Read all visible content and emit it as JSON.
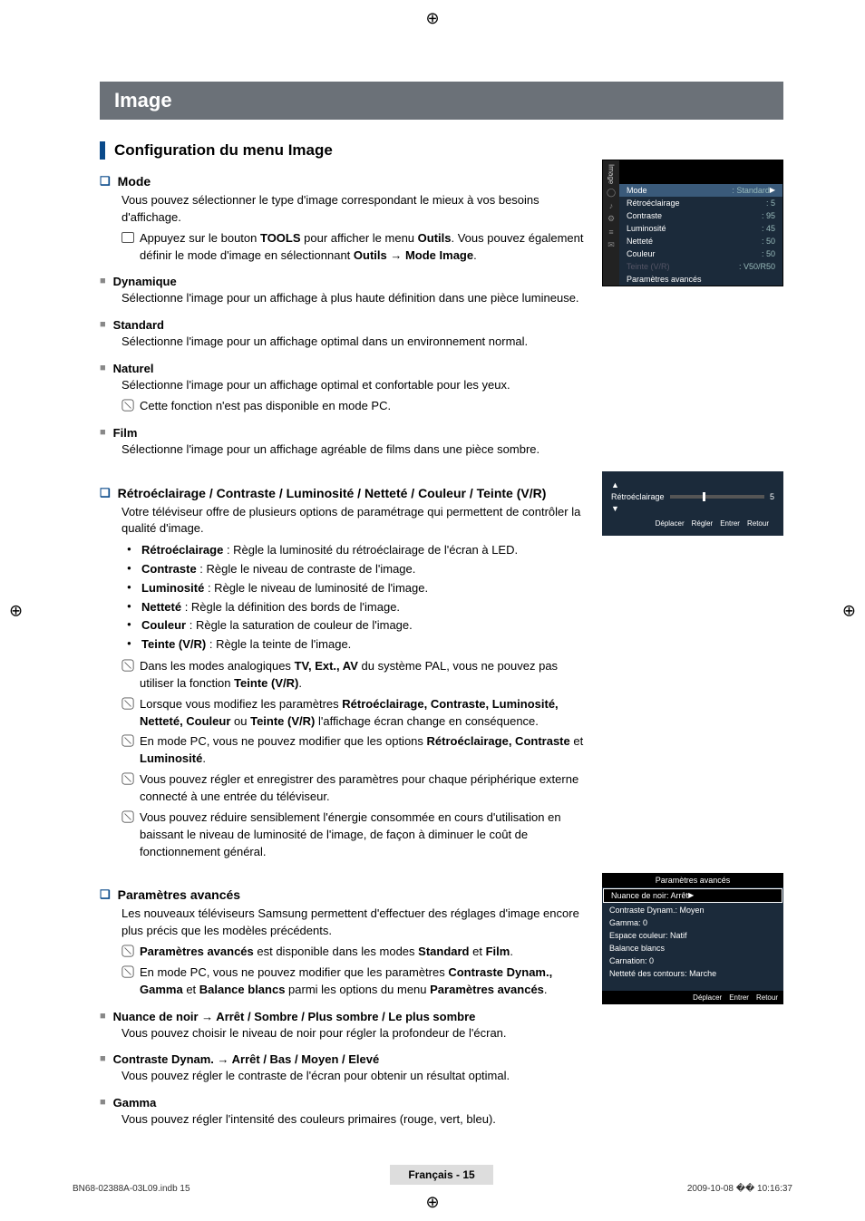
{
  "header": {
    "title": "Image"
  },
  "section": {
    "heading": "Configuration du menu Image"
  },
  "mode": {
    "q": "❏",
    "title": "Mode",
    "intro": "Vous pouvez sélectionner le type d'image correspondant le mieux à vos besoins d'affichage.",
    "tools_line": "Appuyez sur le bouton TOOLS pour afficher le menu Outils. Vous pouvez également définir le mode d'image en sélectionnant Outils → Mode Image.",
    "tools_bold1": "TOOLS",
    "tools_bold2": "Outils",
    "tools_bold3": "Outils → Mode Image",
    "dynamique": {
      "title": "Dynamique",
      "desc": "Sélectionne l'image pour un affichage à plus haute définition dans une pièce lumineuse."
    },
    "standard": {
      "title": "Standard",
      "desc": "Sélectionne l'image pour un affichage optimal dans un environnement normal."
    },
    "naturel": {
      "title": "Naturel",
      "desc": "Sélectionne l'image pour un affichage optimal et confortable pour les yeux.",
      "note": "Cette fonction n'est pas disponible en mode PC."
    },
    "film": {
      "title": "Film",
      "desc": "Sélectionne l'image pour un affichage agréable de films dans une pièce sombre."
    }
  },
  "adjust": {
    "title": "Rétroéclairage / Contraste / Luminosité / Netteté / Couleur / Teinte (V/R)",
    "intro": "Votre téléviseur offre de plusieurs options de paramétrage qui permettent de contrôler la qualité d'image.",
    "items": [
      {
        "name": "Rétroéclairage",
        "desc": " : Règle la luminosité du rétroéclairage de l'écran à LED."
      },
      {
        "name": "Contraste",
        "desc": " : Règle le niveau de contraste de l'image."
      },
      {
        "name": "Luminosité",
        "desc": " : Règle le niveau de luminosité de l'image."
      },
      {
        "name": "Netteté",
        "desc": " : Règle la définition des bords de l'image."
      },
      {
        "name": "Couleur",
        "desc": " : Règle la saturation de couleur de l'image."
      },
      {
        "name": "Teinte (V/R)",
        "desc": " : Règle la teinte de l'image."
      }
    ],
    "notes": [
      "Dans les modes analogiques TV, Ext., AV du système PAL, vous ne pouvez pas utiliser la fonction Teinte (V/R).",
      "Lorsque vous modifiez les paramètres Rétroéclairage, Contraste, Luminosité, Netteté, Couleur ou Teinte (V/R) l'affichage écran change en conséquence.",
      "En mode PC, vous ne pouvez modifier que les options Rétroéclairage, Contraste et Luminosité.",
      "Vous pouvez régler et enregistrer des paramètres pour chaque périphérique externe connecté à une entrée du téléviseur.",
      "Vous pouvez réduire sensiblement l'énergie consommée en cours d'utilisation en baissant le niveau de luminosité de l'image, de façon à diminuer le coût de fonctionnement général."
    ]
  },
  "advanced": {
    "title": "Paramètres avancés",
    "intro": "Les nouveaux téléviseurs Samsung permettent d'effectuer des réglages d'image encore plus précis que les modèles précédents.",
    "note1_pre": "Paramètres avancés",
    "note1_post": " est disponible dans les modes Standard et Film.",
    "note2": "En mode PC, vous ne pouvez modifier que les paramètres Contraste Dynam., Gamma et Balance blancs parmi les options du menu Paramètres avancés.",
    "nuance": {
      "title": "Nuance de noir → Arrêt / Sombre / Plus sombre / Le plus sombre",
      "desc": "Vous pouvez choisir le niveau de noir pour régler la profondeur de l'écran."
    },
    "dynam": {
      "title": "Contraste Dynam. → Arrêt / Bas / Moyen / Elevé",
      "desc": "Vous pouvez régler le contraste de l'écran pour obtenir un résultat optimal."
    },
    "gamma": {
      "title": "Gamma",
      "desc": "Vous pouvez régler l'intensité des couleurs primaires (rouge, vert, bleu)."
    }
  },
  "osd1": {
    "mode_label": "Mode",
    "mode_val": ": Standard",
    "rows": [
      {
        "k": "Rétroéclairage",
        "v": ": 5"
      },
      {
        "k": "Contraste",
        "v": ": 95"
      },
      {
        "k": "Luminosité",
        "v": ": 45"
      },
      {
        "k": "Netteté",
        "v": ": 50"
      },
      {
        "k": "Couleur",
        "v": ": 50"
      },
      {
        "k": "Teinte (V/R)",
        "v": ": V50/R50"
      },
      {
        "k": "Paramètres avancés",
        "v": ""
      }
    ],
    "side_label": "Image"
  },
  "osd2": {
    "label": "Rétroéclairage",
    "value": "5",
    "footer": [
      "Déplacer",
      "Régler",
      "Entrer",
      "Retour"
    ]
  },
  "osd3": {
    "header": "Paramètres avancés",
    "rows": [
      {
        "k": "Nuance de noir",
        "v": ": Arrêt",
        "hl": true
      },
      {
        "k": "Contraste Dynam.",
        "v": ": Moyen"
      },
      {
        "k": "Gamma",
        "v": ": 0"
      },
      {
        "k": "Espace couleur",
        "v": ": Natif"
      },
      {
        "k": "Balance blancs",
        "v": ""
      },
      {
        "k": "Carnation",
        "v": ": 0"
      },
      {
        "k": "Netteté des contours",
        "v": ": Marche"
      }
    ],
    "footer": [
      "Déplacer",
      "Entrer",
      "Retour"
    ]
  },
  "pagefoot": {
    "lang": "Français - 15",
    "left": "BN68-02388A-03L09.indb   15",
    "right_date": "2009-10-08   �� 10:16:37"
  }
}
